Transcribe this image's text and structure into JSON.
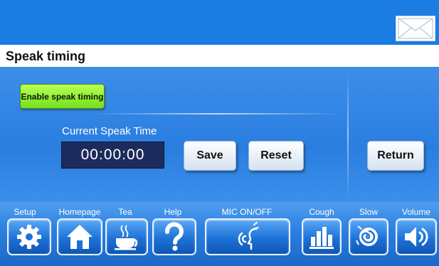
{
  "header": {
    "mail_icon": "envelope-icon"
  },
  "page": {
    "title": "Speak timing"
  },
  "main": {
    "enable_label": "Enable speak timing",
    "speak_time_label": "Current Speak Time",
    "speak_time_value": "00:00:00",
    "save_label": "Save",
    "reset_label": "Reset",
    "return_label": "Return"
  },
  "nav": [
    {
      "label": "Setup",
      "icon": "gear-icon"
    },
    {
      "label": "Homepage",
      "icon": "home-icon"
    },
    {
      "label": "Tea",
      "icon": "tea-cup-icon"
    },
    {
      "label": "Help",
      "icon": "question-mark-icon"
    },
    {
      "label": "MIC ON/OFF",
      "icon": "speaking-head-icon"
    },
    {
      "label": "Cough",
      "icon": "bar-chart-icon"
    },
    {
      "label": "Slow",
      "icon": "snail-icon"
    },
    {
      "label": "Volume",
      "icon": "speaker-icon"
    }
  ],
  "colors": {
    "top_bar": "#1b7ce3",
    "panel": "#2a7ee0",
    "enable_button": "#73e01d",
    "time_display": "#1d2b5c"
  }
}
